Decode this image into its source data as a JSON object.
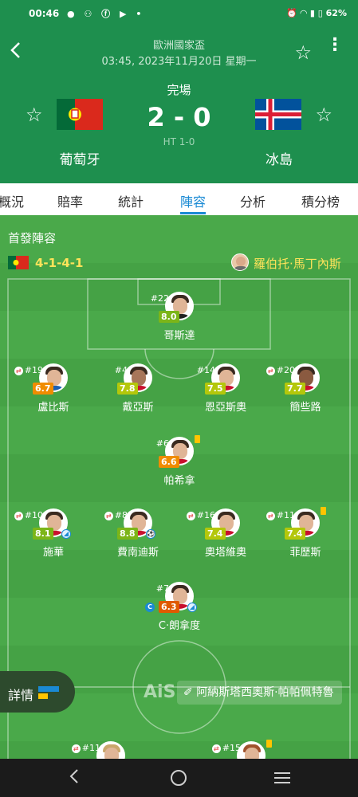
{
  "status_bar": {
    "time": "00:46",
    "left_icons": [
      "chat-bubble-icon",
      "network-icon",
      "facebook-icon",
      "youtube-icon",
      "dot-icon"
    ],
    "battery": "62%"
  },
  "header": {
    "competition": "歐洲國家盃",
    "datetime": "03:45, 2023年11月20日 星期一",
    "status": "完場",
    "score": "2 - 0",
    "halftime": "HT 1-0",
    "home": {
      "name": "葡萄牙",
      "flag": "portugal-flag"
    },
    "away": {
      "name": "冰島",
      "flag": "iceland-flag"
    }
  },
  "tabs": [
    {
      "label": "概況",
      "active": false
    },
    {
      "label": "賠率",
      "active": false
    },
    {
      "label": "統計",
      "active": false
    },
    {
      "label": "陣容",
      "active": true
    },
    {
      "label": "分析",
      "active": false
    },
    {
      "label": "積分榜",
      "active": false
    }
  ],
  "lineup": {
    "section_title": "首發陣容",
    "formation": "4-1-4-1",
    "coach": "羅伯托·馬丁內斯",
    "players": [
      {
        "number": "#22",
        "name": "哥斯達",
        "rating": "8.0",
        "rating_color": "#7cb518",
        "sub": false
      },
      {
        "number": "#19",
        "name": "盧比斯",
        "rating": "6.7",
        "rating_color": "#f08c00",
        "sub": true
      },
      {
        "number": "#4",
        "name": "戴亞斯",
        "rating": "7.8",
        "rating_color": "#b4c70b",
        "sub": false
      },
      {
        "number": "#14",
        "name": "恩亞斯奧",
        "rating": "7.5",
        "rating_color": "#b4c70b",
        "sub": false
      },
      {
        "number": "#20",
        "name": "簡些路",
        "rating": "7.7",
        "rating_color": "#b4c70b",
        "sub": true
      },
      {
        "number": "#6",
        "name": "帕希拿",
        "rating": "6.6",
        "rating_color": "#f08c00",
        "sub": false,
        "card": "yellow"
      },
      {
        "number": "#10",
        "name": "施華",
        "rating": "8.1",
        "rating_color": "#7cb518",
        "sub": true
      },
      {
        "number": "#8",
        "name": "費南迪斯",
        "rating": "8.8",
        "rating_color": "#7cb518",
        "sub": true,
        "goal": true
      },
      {
        "number": "#16",
        "name": "奧塔維奧",
        "rating": "7.4",
        "rating_color": "#b4c70b",
        "sub": true
      },
      {
        "number": "#11",
        "name": "菲歷斯",
        "rating": "7.4",
        "rating_color": "#b4c70b",
        "sub": true,
        "card": "yellow"
      },
      {
        "number": "#7",
        "name": "C·朗拿度",
        "rating": "6.3",
        "rating_color": "#e05a00",
        "sub": false,
        "captain": "C"
      }
    ],
    "bottom_players": [
      {
        "number": "#11",
        "sub": true
      },
      {
        "number": "#15",
        "sub": true,
        "card": "yellow"
      }
    ]
  },
  "detail_button": {
    "label": "詳情"
  },
  "watermark": "AiS",
  "referee": {
    "name": "阿納斯塔西奧斯·帕帕佩特魯"
  },
  "colors": {
    "header_green": "#1e8f4e",
    "accent_blue": "#1a8ad4",
    "formation_yellow": "#ffe35a"
  }
}
